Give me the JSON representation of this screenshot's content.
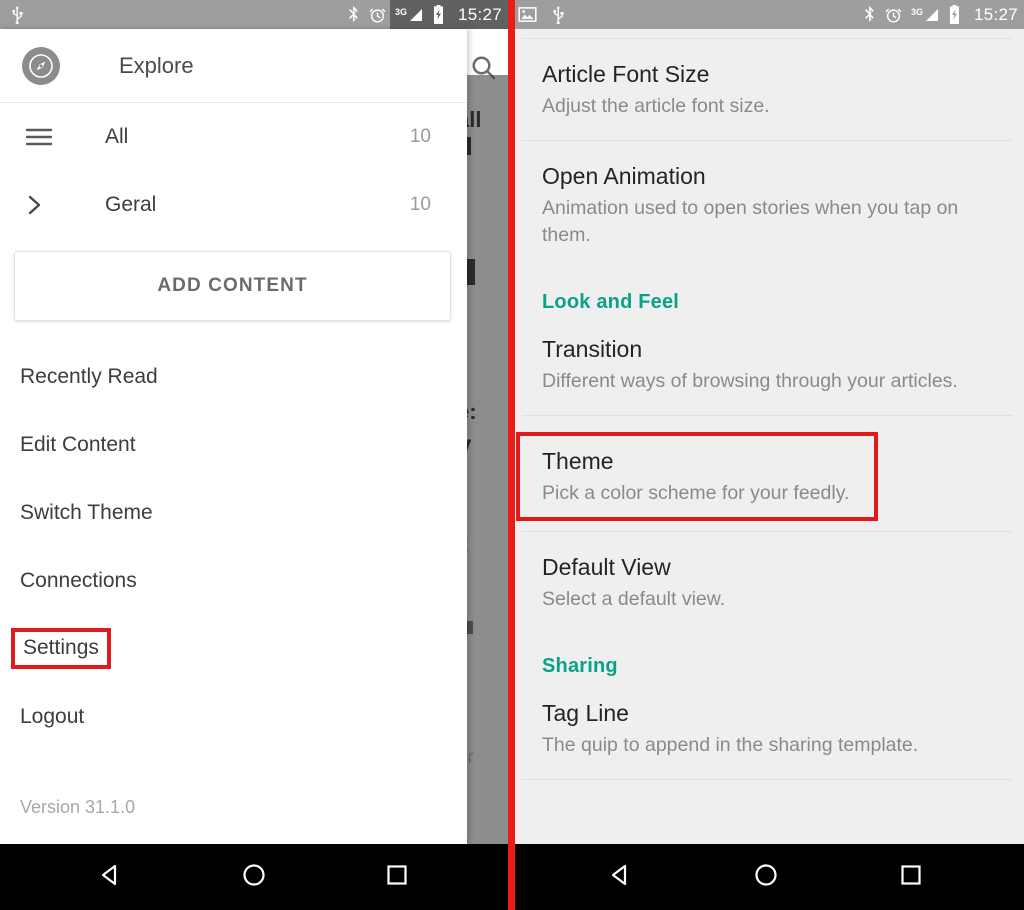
{
  "status_bar": {
    "time": "15:27",
    "left_icons_left_panel": [
      "usb-icon"
    ],
    "left_icons_right_panel": [
      "image-icon",
      "usb-icon"
    ],
    "right_icons": [
      "bluetooth-icon",
      "alarm-icon",
      "signal-3g-icon",
      "battery-charging-icon"
    ],
    "network_label": "3G"
  },
  "colors": {
    "accent_teal": "#0aa287",
    "highlight_red": "#e01b1b",
    "split_red": "#e81c1c",
    "status_bar_gray": "#9e9e9e",
    "panel_background": "#efefef",
    "drawer_background": "#ffffff",
    "scrim_gray": "#8d8d8d"
  },
  "drawer": {
    "header": {
      "icon": "compass-icon",
      "label": "Explore"
    },
    "feeds": [
      {
        "icon": "hamburger-icon",
        "label": "All",
        "count": "10"
      },
      {
        "icon": "chevron-right-icon",
        "label": "Geral",
        "count": "10"
      }
    ],
    "add_content_label": "ADD CONTENT",
    "menu_items": [
      {
        "label": "Recently Read",
        "highlighted": false
      },
      {
        "label": "Edit Content",
        "highlighted": false
      },
      {
        "label": "Switch Theme",
        "highlighted": false
      },
      {
        "label": "Connections",
        "highlighted": false
      },
      {
        "label": "Settings",
        "highlighted": true
      },
      {
        "label": "Logout",
        "highlighted": false
      }
    ],
    "version": "Version 31.1.0"
  },
  "background_scrim": {
    "search_icon": "search-icon",
    "fragments": [
      "all",
      "e:",
      "y",
      "rt",
      "er"
    ]
  },
  "settings": {
    "items": [
      {
        "title": "Article Font Size",
        "subtitle": "Adjust the article font size.",
        "highlighted": false,
        "section": null
      },
      {
        "title": "Open Animation",
        "subtitle": "Animation used to open stories when you tap on them.",
        "highlighted": false,
        "section": null
      },
      {
        "title": "Transition",
        "subtitle": "Different ways of browsing through your articles.",
        "highlighted": false,
        "section": "Look and Feel"
      },
      {
        "title": "Theme",
        "subtitle": "Pick a color scheme for your feedly.",
        "highlighted": true,
        "section": null
      },
      {
        "title": "Default View",
        "subtitle": "Select a default view.",
        "highlighted": false,
        "section": null
      },
      {
        "title": "Tag Line",
        "subtitle": "The quip to append in the sharing template.",
        "highlighted": false,
        "section": "Sharing"
      }
    ],
    "sections": [
      "Look and Feel",
      "Sharing"
    ]
  },
  "navbar": {
    "buttons": [
      {
        "name": "back-button",
        "icon": "triangle-left-icon"
      },
      {
        "name": "home-button",
        "icon": "circle-icon"
      },
      {
        "name": "recents-button",
        "icon": "square-icon"
      }
    ]
  }
}
